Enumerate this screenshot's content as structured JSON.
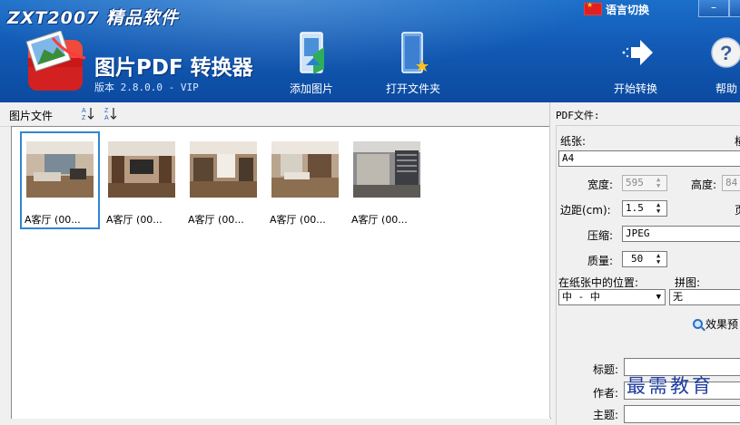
{
  "header": {
    "brand": "ZXT2007 精品软件",
    "app_title": "图片PDF 转换器",
    "version": "版本 2.8.0.0 - VIP",
    "language_label": "语言切换",
    "minimize": "–",
    "toolbar": {
      "add_image": "添加图片",
      "open_folder": "打开文件夹",
      "start_convert": "开始转换",
      "help": "帮助"
    }
  },
  "left_panel": {
    "title": "图片文件",
    "images": [
      {
        "caption": "A客厅 (00...",
        "selected": true
      },
      {
        "caption": "A客厅 (00...",
        "selected": false
      },
      {
        "caption": "A客厅 (00...",
        "selected": false
      },
      {
        "caption": "A客厅 (00...",
        "selected": false
      },
      {
        "caption": "A客厅 (00...",
        "selected": false
      }
    ]
  },
  "right_panel": {
    "title": "PDF文件:",
    "paper_label": "纸张:",
    "orientation_label": "横",
    "paper_value": "A4",
    "width_label": "宽度:",
    "width_value": "595",
    "height_label": "高度:",
    "height_value": "84",
    "margin_label": "边距(cm):",
    "margin_value": "1.5",
    "page_label": "页",
    "compress_label": "压缩:",
    "compress_value": "JPEG",
    "quality_label": "质量:",
    "quality_value": "50",
    "position_label": "在纸张中的位置:",
    "position_value": "中 - 中",
    "collage_label": "拼图:",
    "collage_value": "无",
    "preview_label": "效果预",
    "doc_title_label": "标题:",
    "author_label": "作者:",
    "subject_label": "主题:"
  },
  "watermark": "最需教育",
  "colors": {
    "header_blue": "#125ab5",
    "selection": "#2f86d4"
  }
}
